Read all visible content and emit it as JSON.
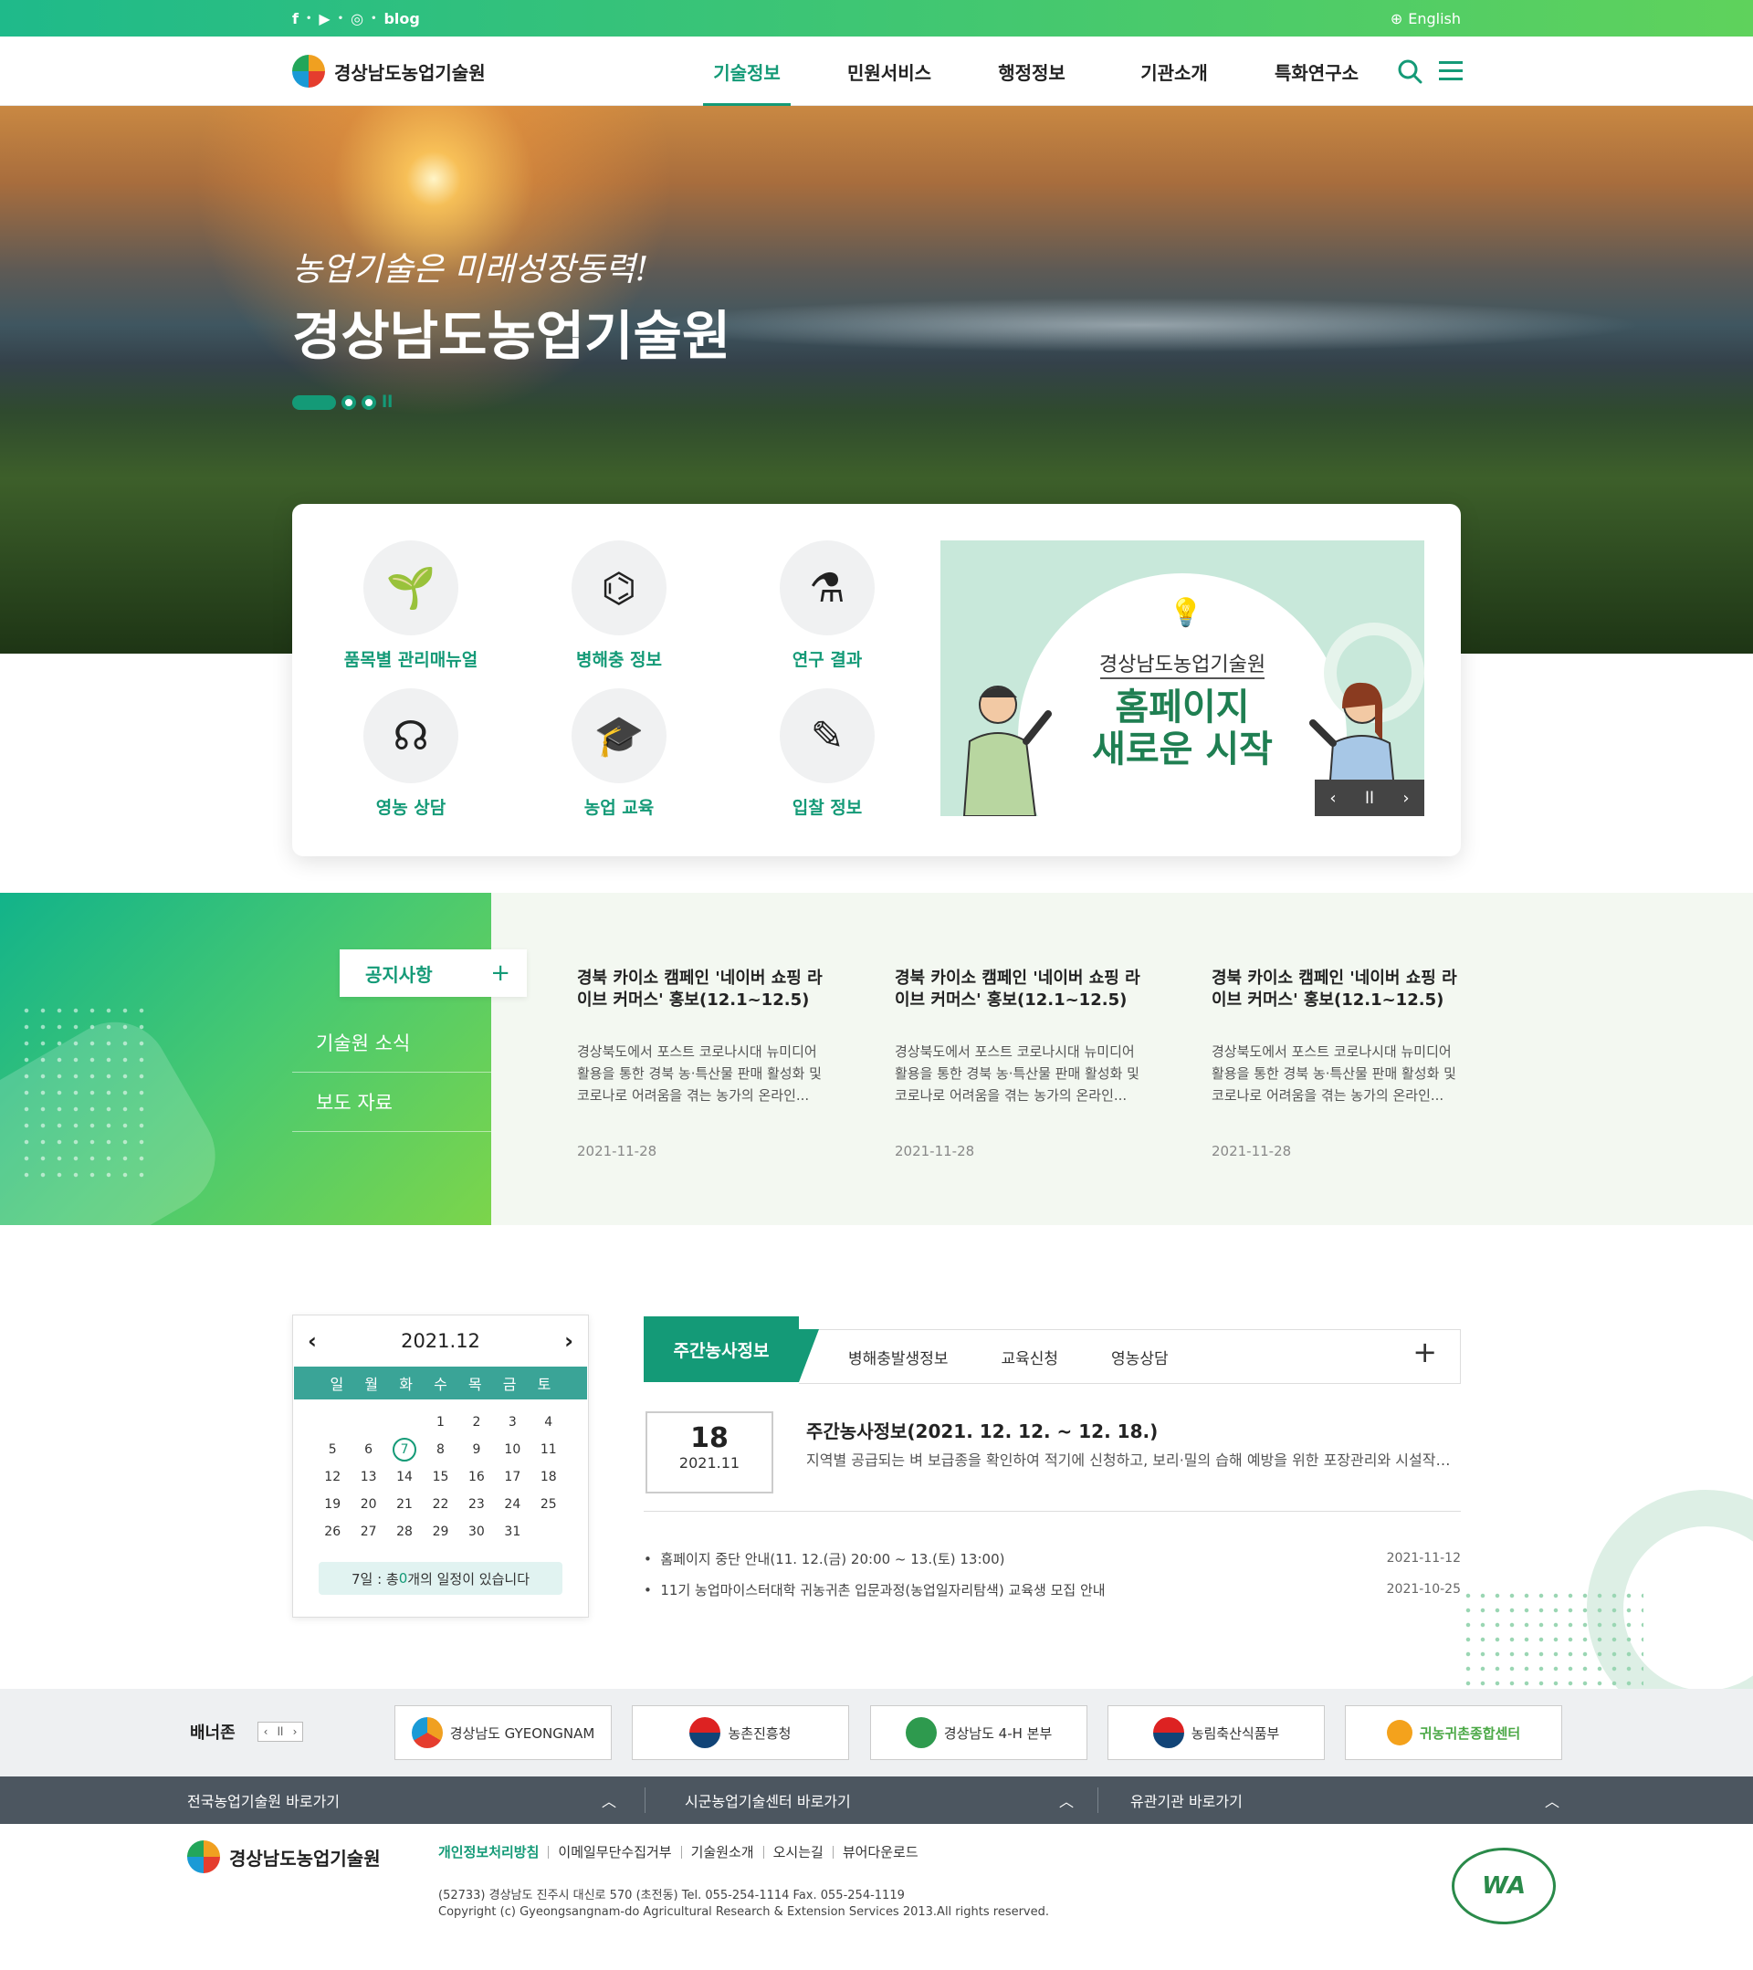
{
  "topbar": {
    "social": [
      "f",
      "▶",
      "◎",
      "blog"
    ],
    "language": "English"
  },
  "header": {
    "site_name": "경상남도농업기술원",
    "nav": [
      "기술정보",
      "민원서비스",
      "행정정보",
      "기관소개",
      "특화연구소"
    ],
    "active_nav": "기술정보"
  },
  "hero": {
    "subtitle": "농업기술은 미래성장동력!",
    "title": "경상남도농업기술원"
  },
  "quick_menu": [
    {
      "label": "품목별 관리매뉴얼",
      "icon": "seedling-hand-icon"
    },
    {
      "label": "병해충 정보",
      "icon": "molecule-icon"
    },
    {
      "label": "연구 결과",
      "icon": "lab-flask-icon"
    },
    {
      "label": "영농 상담",
      "icon": "headset-icon"
    },
    {
      "label": "농업 교육",
      "icon": "graduation-cap-icon"
    },
    {
      "label": "입찰 정보",
      "icon": "document-pen-icon"
    }
  ],
  "promo": {
    "org": "경상남도농업기술원",
    "headline1": "홈페이지",
    "headline2": "새로운 시작"
  },
  "news": {
    "tabs": [
      "공지사항",
      "기술원 소식",
      "보도 자료"
    ],
    "active_tab": "공지사항",
    "items": [
      {
        "title": "경북 카이소 캠페인 '네이버 쇼핑 라이브 커머스' 홍보(12.1~12.5)",
        "body": "경상북도에서 포스트 코로나시대 뉴미디어 활용을 통한 경북 농·특산물 판매 활성화 및 코로나로 어려움을 겪는 농가의 온라인...",
        "date": "2021-11-28"
      },
      {
        "title": "경북 카이소 캠페인 '네이버 쇼핑 라이브 커머스' 홍보(12.1~12.5)",
        "body": "경상북도에서 포스트 코로나시대 뉴미디어 활용을 통한 경북 농·특산물 판매 활성화 및 코로나로 어려움을 겪는 농가의 온라인...",
        "date": "2021-11-28"
      },
      {
        "title": "경북 카이소 캠페인 '네이버 쇼핑 라이브 커머스' 홍보(12.1~12.5)",
        "body": "경상북도에서 포스트 코로나시대 뉴미디어 활용을 통한 경북 농·특산물 판매 활성화 및 코로나로 어려움을 겪는 농가의 온라인...",
        "date": "2021-11-28"
      }
    ]
  },
  "calendar": {
    "month": "2021.12",
    "weekdays": [
      "일",
      "월",
      "화",
      "수",
      "목",
      "금",
      "토"
    ],
    "weeks": [
      [
        "",
        "",
        "",
        "1",
        "2",
        "3",
        "4"
      ],
      [
        "5",
        "6",
        "7",
        "8",
        "9",
        "10",
        "11"
      ],
      [
        "12",
        "13",
        "14",
        "15",
        "16",
        "17",
        "18"
      ],
      [
        "19",
        "20",
        "21",
        "22",
        "23",
        "24",
        "25"
      ],
      [
        "26",
        "27",
        "28",
        "29",
        "30",
        "31",
        ""
      ]
    ],
    "selected_day": "7",
    "note_prefix": "7일 : 총 ",
    "note_count": "0",
    "note_suffix": "개의 일정이 있습니다"
  },
  "weekly": {
    "tabs": [
      "주간농사정보",
      "병해충발생정보",
      "교육신청",
      "영농상담"
    ],
    "active_tab": "주간농사정보",
    "featured": {
      "day": "18",
      "yearmonth": "2021.11",
      "title": "주간농사정보(2021. 12. 12. ~ 12. 18.)",
      "body": "지역별 공급되는 벼 보급종을 확인하여 적기에 신청하고, 보리·밀의 습해 예방을 위한 포장관리와 시설작물의..."
    },
    "list": [
      {
        "title": "홈페이지 중단 안내(11. 12.(금) 20:00 ~ 13.(토) 13:00)",
        "date": "2021-11-12"
      },
      {
        "title": "11기 농업마이스터대학 귀농귀촌 입문과정(농업일자리탐색) 교육생 모집 안내",
        "date": "2021-10-25"
      }
    ]
  },
  "banner_zone": {
    "label": "배너존",
    "banners": [
      "경상남도 GYEONGNAM",
      "농촌진흥청",
      "경상남도 4-H 본부",
      "농림축산식품부",
      "귀농귀촌종합센터"
    ]
  },
  "footer_links": [
    "전국농업기술원 바로가기",
    "시군농업기술센터 바로가기",
    "유관기관 바로가기"
  ],
  "footer": {
    "site_name": "경상남도농업기술원",
    "menu": [
      "개인정보처리방침",
      "이메일무단수집거부",
      "기술원소개",
      "오시는길",
      "뷰어다운로드"
    ],
    "address": "(52733) 경상남도 진주시 대신로 570 (초전동) Tel. 055-254-1114   Fax. 055-254-1119",
    "copyright": "Copyright (c) Gyeongsangnam-do Agricultural Research & Extension Services 2013.All rights reserved.",
    "badge": "WA"
  },
  "colors": {
    "primary": "#149a77",
    "accent_green": "#5fd25c",
    "footer_bar": "#4c5660"
  }
}
